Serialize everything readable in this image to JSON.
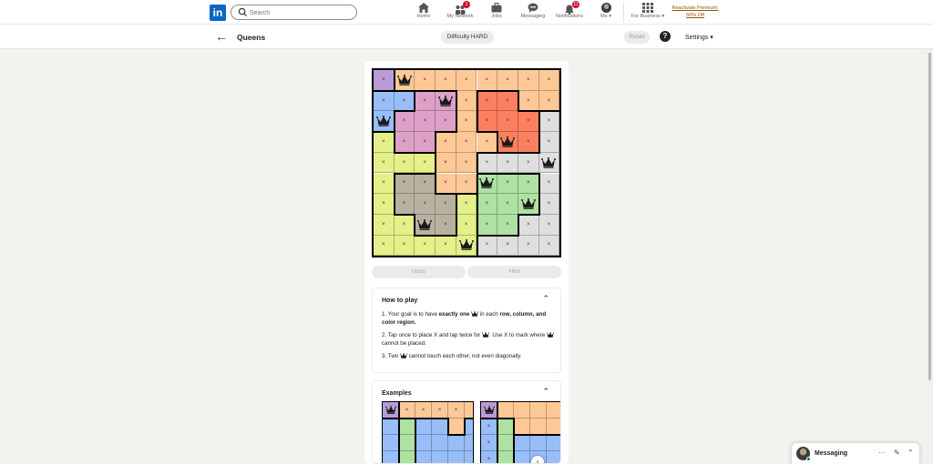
{
  "nav": {
    "logo": "in",
    "search_placeholder": "Search",
    "items": [
      {
        "label": "Home",
        "icon": "home-icon",
        "badge": ""
      },
      {
        "label": "My Network",
        "icon": "network-icon",
        "badge": "1"
      },
      {
        "label": "Jobs",
        "icon": "jobs-icon",
        "badge": ""
      },
      {
        "label": "Messaging",
        "icon": "messaging-icon",
        "badge": ""
      },
      {
        "label": "Notifications",
        "icon": "bell-icon",
        "badge": "11"
      },
      {
        "label": "Me ▾",
        "icon": "avatar",
        "badge": ""
      },
      {
        "label": "For Business ▾",
        "icon": "grid-icon",
        "badge": ""
      }
    ],
    "premium_line1": "Reactivate Premium:",
    "premium_line2": "50% Off"
  },
  "game": {
    "title": "Queens",
    "difficulty": "Difficulty HARD",
    "reset": "Reset",
    "help": "?",
    "settings": "Settings ▾",
    "undo": "Undo",
    "hint": "Hint",
    "colors": {
      "P": "#b99bd6",
      "O": "#fec997",
      "B": "#98bdf9",
      "K": "#dda0c6",
      "R": "#fc8060",
      "G": "#dfdfdf",
      "Y": "#e4f08a",
      "T": "#b8b1a1",
      "N": "#aee1a2"
    },
    "grid": [
      "POOOOOOOO",
      "BBKKORROO",
      "BKKKORRRG",
      "YKKOOORRG",
      "YYYOOGGGG",
      "YTTOONNNG",
      "YTTTYNNNG",
      "YYTTYNNGG",
      "YYYYYGGGG"
    ],
    "marks": [
      "xQxxxxxxx",
      "xxxQxxxxx",
      "Qxxxxxxxx",
      "xxxxxxQxx",
      "xxxxxxxxQ",
      "xxxxxQxxx",
      "xxxxxxxQx",
      "xxQxxxxxx",
      "xxxxQxxxx"
    ]
  },
  "how_to_play": {
    "title": "How to play",
    "step1_a": "1. Your goal is to have ",
    "step1_b": "exactly one",
    "step1_c": " in each ",
    "step1_d": "row, column, and color region.",
    "step2_a": "2. Tap once to place X and tap twice for ",
    "step2_b": ". Use X to mark where ",
    "step2_c": " cannot be placed.",
    "step3_a": "3. Two ",
    "step3_b": " cannot touch each other, not even diagonally."
  },
  "examples": {
    "title": "Examples",
    "board1_grid": [
      "POOOOO",
      "BNBBOB",
      "BNBBBB",
      "BNBBBB",
      "BBBBBB"
    ],
    "board1_marks": [
      "Qxxxx.",
      "......",
      "......",
      "......",
      "......"
    ],
    "board2_grid": [
      "POOOO",
      "BNOOO",
      "BNBBB",
      "BNBBB",
      "BNBBB"
    ],
    "board2_marks": [
      "Q....",
      "x....",
      "x....",
      "x....",
      "x...."
    ]
  },
  "messaging": {
    "label": "Messaging",
    "more": "···",
    "compose": "✎",
    "collapse": "⌃"
  }
}
